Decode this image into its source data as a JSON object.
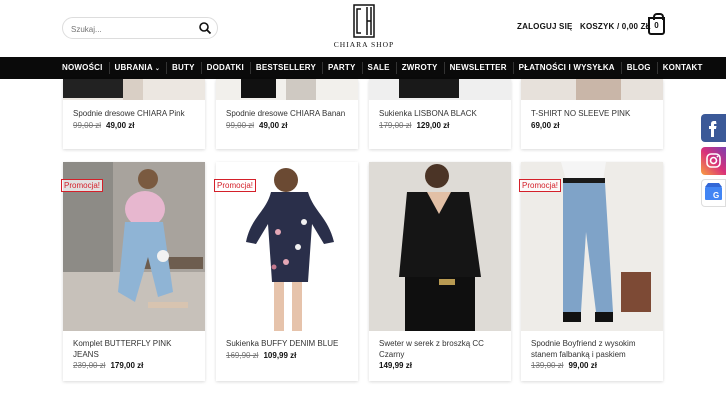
{
  "header": {
    "search_placeholder": "Szukaj...",
    "logo_text": "CHIARA SHOP",
    "login_label": "ZALOGUJ SIĘ",
    "cart_label": "KOSZYK / 0,00 ZŁ",
    "cart_count": "0"
  },
  "nav": {
    "items": [
      {
        "label": "NOWOŚCI"
      },
      {
        "label": "UBRANIA"
      },
      {
        "label": "BUTY"
      },
      {
        "label": "DODATKI"
      },
      {
        "label": "BESTSELLERY"
      },
      {
        "label": "PARTY"
      },
      {
        "label": "SALE"
      },
      {
        "label": "ZWROTY"
      },
      {
        "label": "NEWSLETTER"
      },
      {
        "label": "PŁATNOŚCI I WYSYŁKA"
      },
      {
        "label": "BLOG"
      },
      {
        "label": "KONTAKT"
      }
    ]
  },
  "products_top": [
    {
      "name": "Spodnie dresowe CHIARA Pink",
      "old_price": "99,00 zł",
      "price": "49,00 zł"
    },
    {
      "name": "Spodnie dresowe CHIARA Banan",
      "old_price": "99,00 zł",
      "price": "49,00 zł"
    },
    {
      "name": "Sukienka LISBONA BLACK",
      "old_price": "179,00 zł",
      "price": "129,00 zł"
    },
    {
      "name": "T-SHIRT NO SLEEVE PINK",
      "old_price": "",
      "price": "69,00 zł"
    }
  ],
  "products_bottom": [
    {
      "name": "Komplet BUTTERFLY PINK JEANS",
      "old_price": "239,00 zł",
      "price": "179,00 zł",
      "badge": "Promocja!"
    },
    {
      "name": "Sukienka BUFFY DENIM BLUE",
      "old_price": "169,90 zł",
      "price": "109,99 zł",
      "badge": "Promocja!"
    },
    {
      "name": "Sweter w serek z broszką CC Czarny",
      "old_price": "",
      "price": "149,99 zł",
      "badge": ""
    },
    {
      "name": "Spodnie Boyfriend z wysokim stanem falbanką i paskiem",
      "old_price": "139,00 zł",
      "price": "99,00 zł",
      "badge": "Promocja!"
    }
  ],
  "colors": {
    "nav_bg": "#0a0a0a",
    "promo_red": "#d4202a",
    "facebook": "#3b5998"
  },
  "social": {
    "icons": [
      "facebook-icon",
      "instagram-icon",
      "google-my-business-icon"
    ]
  }
}
